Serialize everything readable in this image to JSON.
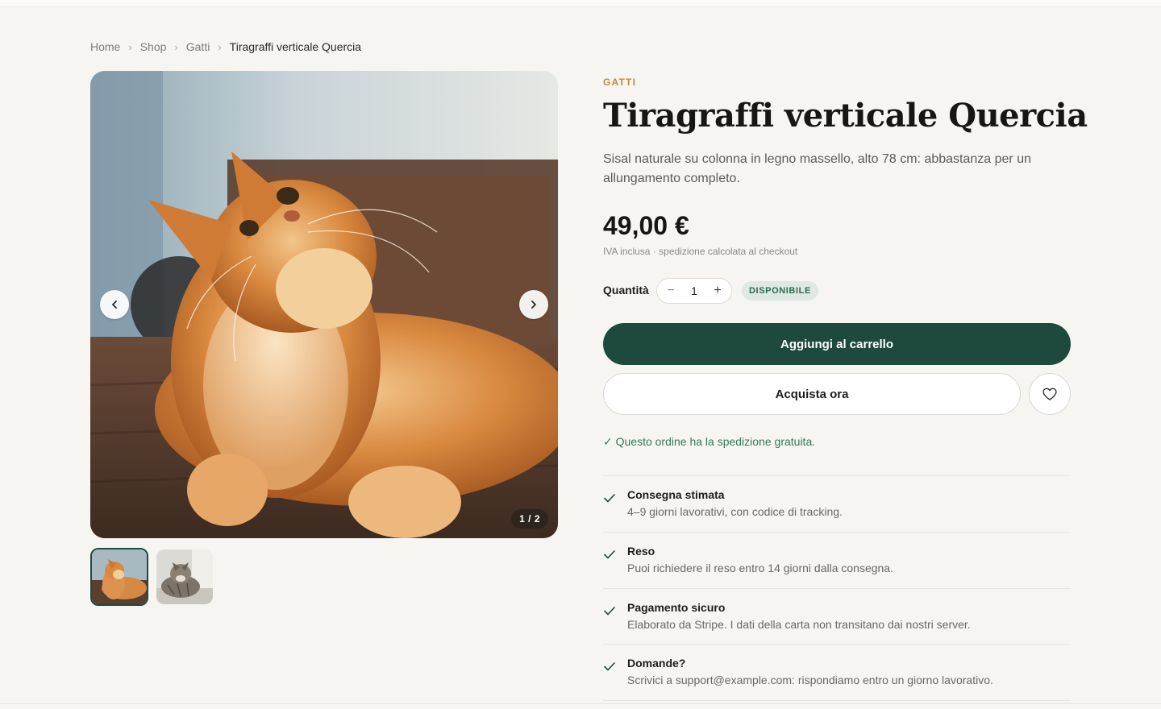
{
  "breadcrumb": {
    "items": [
      "Home",
      "Shop",
      "Gatti"
    ],
    "current": "Tiragraffi verticale Quercia",
    "separator": "›"
  },
  "gallery": {
    "counter": "1 / 2",
    "prev_icon": "chevron-left-icon",
    "next_icon": "chevron-right-icon",
    "thumbnails": [
      "orange-cat-photo",
      "tabby-cat-photo"
    ],
    "selected_index": 0
  },
  "product": {
    "category": "GATTI",
    "title": "Tiragraffi verticale Quercia",
    "description": "Sisal naturale su colonna in legno massello, alto 78 cm: abbastanza per un allungamento completo.",
    "price": "49,00 €",
    "price_note": "IVA inclusa · spedizione calcolata al checkout"
  },
  "purchase": {
    "quantity_label": "Quantità",
    "quantity_value": "1",
    "decrement": "−",
    "increment": "+",
    "stock_badge": "DISPONIBILE",
    "add_to_cart": "Aggiungi al carrello",
    "buy_now": "Acquista ora",
    "wishlist_icon": "heart-icon",
    "free_shipping": "✓ Questo ordine ha la spedizione gratuita."
  },
  "features": [
    {
      "title": "Consegna stimata",
      "text": "4–9 giorni lavorativi, con codice di tracking."
    },
    {
      "title": "Reso",
      "text": "Puoi richiedere il reso entro 14 giorni dalla consegna."
    },
    {
      "title": "Pagamento sicuro",
      "text": "Elaborato da Stripe. I dati della carta non transitano dai nostri server."
    },
    {
      "title": "Domande?",
      "text": "Scrivici a support@example.com: rispondiamo entro un giorno lavorativo."
    }
  ],
  "colors": {
    "background": "#f6f5f2",
    "accent_green": "#1e4a3d",
    "category_orange": "#c28a3a",
    "success_green": "#2e7a57",
    "badge_bg": "#dde9e2"
  }
}
